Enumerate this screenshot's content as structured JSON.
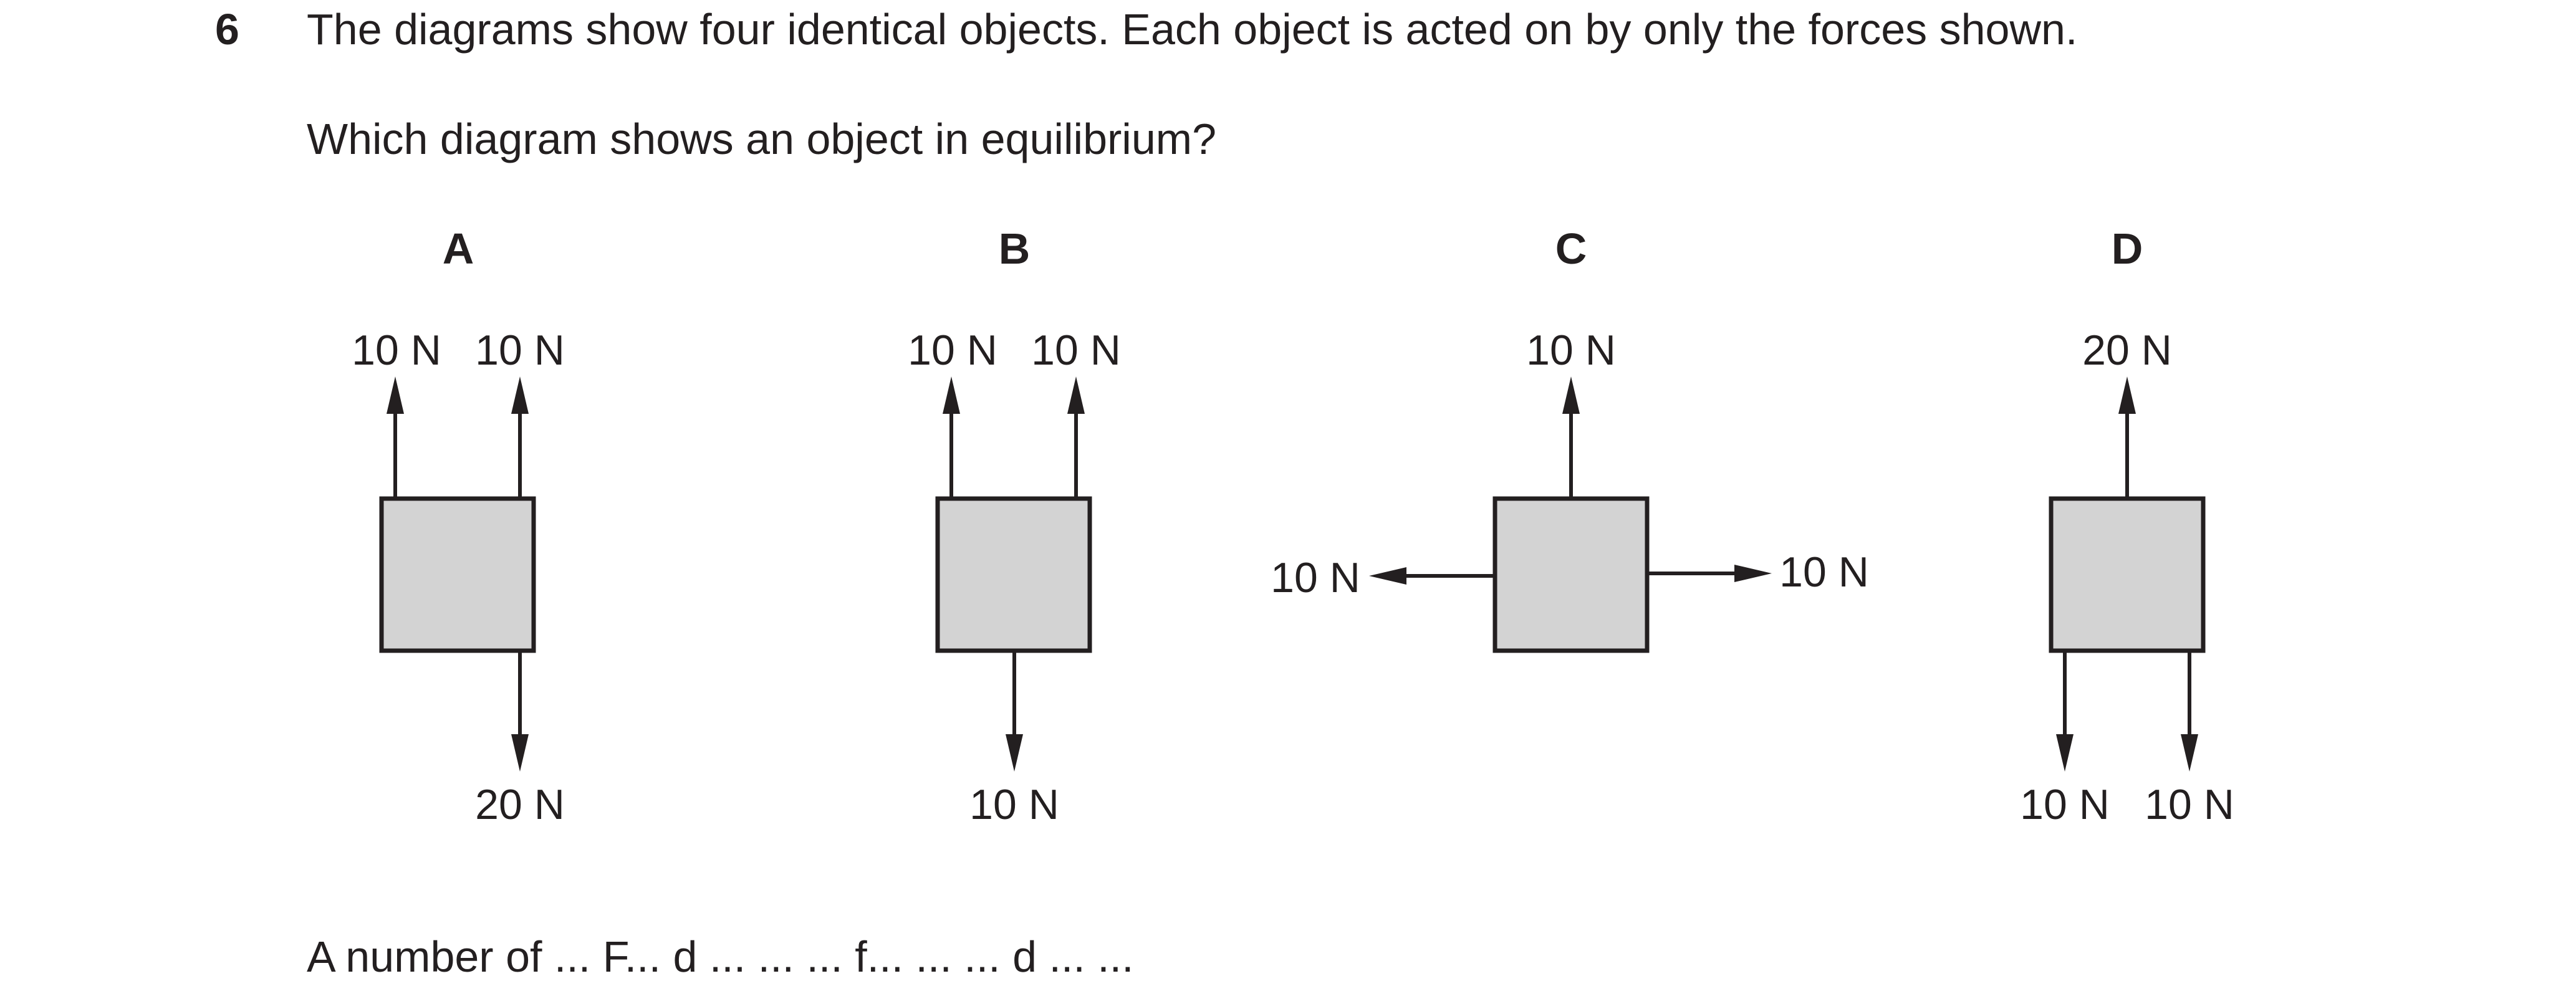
{
  "question": {
    "number": "6",
    "stem": "The diagrams show four identical objects. Each object is acted on by only the forces shown.",
    "prompt": "Which diagram shows an object in equilibrium?"
  },
  "diagrams": {
    "A": {
      "letter": "A",
      "top_left": "10 N",
      "top_right": "10 N",
      "bottom": "20 N"
    },
    "B": {
      "letter": "B",
      "top_left": "10 N",
      "top_right": "10 N",
      "bottom": "10 N"
    },
    "C": {
      "letter": "C",
      "top": "10 N",
      "left": "10 N",
      "right": "10 N"
    },
    "D": {
      "letter": "D",
      "top": "20 N",
      "bottom_left": "10 N",
      "bottom_right": "10 N"
    }
  },
  "cut_text": "A number of ... F... d ... ... ... f... ... ... d ... ..."
}
